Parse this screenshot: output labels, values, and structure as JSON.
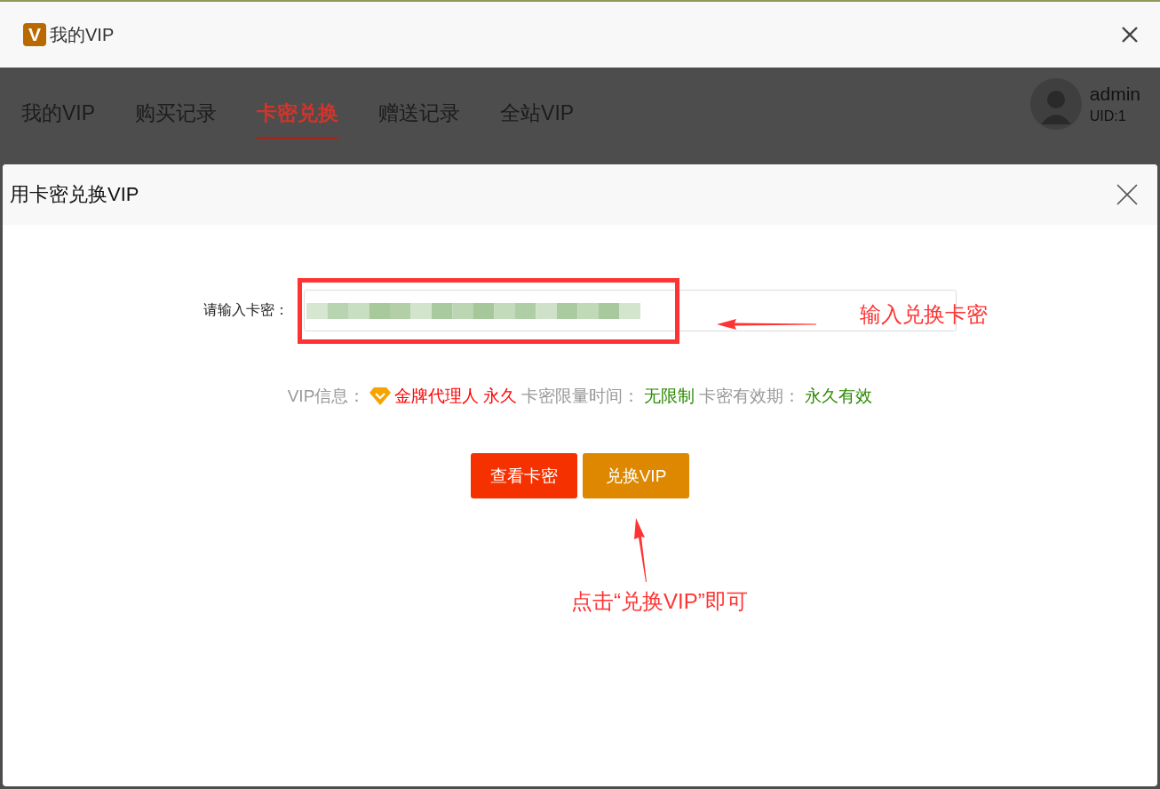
{
  "window": {
    "title": "我的VIP",
    "logo": "V"
  },
  "tabs": [
    {
      "label": "我的VIP",
      "selected": false
    },
    {
      "label": "购买记录",
      "selected": false
    },
    {
      "label": "卡密兑换",
      "selected": true
    },
    {
      "label": "赠送记录",
      "selected": false
    },
    {
      "label": "全站VIP",
      "selected": false
    }
  ],
  "user": {
    "name": "admin",
    "uid": "UID:1"
  },
  "dialog": {
    "title": "用卡密兑换VIP",
    "field": {
      "label": "请输入卡密：",
      "value_blurred": true,
      "highlighted": true
    },
    "info": [
      {
        "text": "VIP信息：",
        "kind": "label",
        "color": "#999999"
      },
      {
        "text": "金牌代理人",
        "kind": "level",
        "color": "#ff0000"
      },
      {
        "text": "永久",
        "kind": "value",
        "color": "#ff0000"
      },
      {
        "text": "卡密限量时间：",
        "kind": "label",
        "color": "#999999"
      },
      {
        "text": "无限制",
        "kind": "value",
        "color": "#2b8a00"
      },
      {
        "text": "卡密有效期：",
        "kind": "label",
        "color": "#999999"
      },
      {
        "text": "永久有效",
        "kind": "value",
        "color": "#2b8a00"
      }
    ],
    "buttons": [
      {
        "label": "查看卡密",
        "kind": "danger"
      },
      {
        "label": "兑换VIP",
        "kind": "warning"
      }
    ]
  },
  "annotations": [
    {
      "text": "输入兑换卡密",
      "kind": "left"
    },
    {
      "text": "点击“兑换VIP”即可",
      "kind": "up"
    }
  ]
}
